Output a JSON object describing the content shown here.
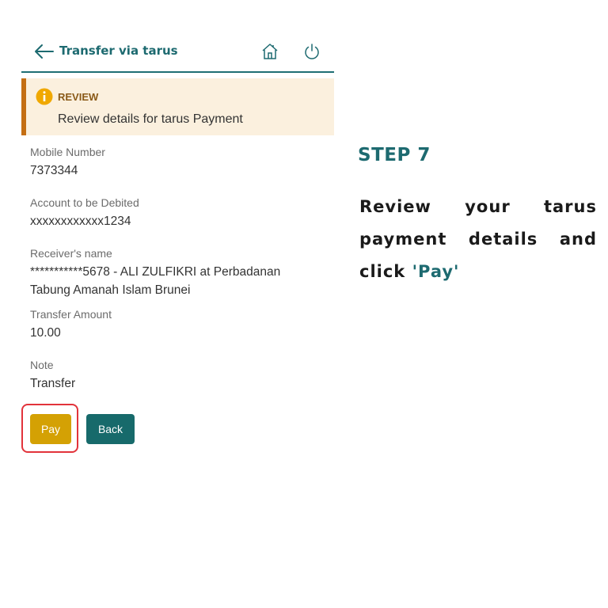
{
  "header": {
    "title": "Transfer via tarus",
    "icons": [
      "back-arrow-icon",
      "home-icon",
      "power-icon"
    ]
  },
  "review": {
    "title": "REVIEW",
    "text": "Review details for tarus Payment",
    "icon": "info-icon"
  },
  "fields": [
    {
      "label": "Mobile Number",
      "value": "7373344"
    },
    {
      "label": "Account to be Debited",
      "value": "xxxxxxxxxxxx1234"
    },
    {
      "label": "Receiver's name",
      "value": "***********5678 - ALI ZULFIKRI at Perbadanan Tabung Amanah Islam Brunei"
    },
    {
      "label": "Transfer Amount",
      "value": "10.00"
    },
    {
      "label": "Note",
      "value": "Transfer"
    }
  ],
  "actions": {
    "pay_label": "Pay",
    "back_label": "Back"
  },
  "instruction": {
    "step": "STEP 7",
    "text": "Review your tarus payment details and click",
    "highlight": "'Pay'"
  },
  "colors": {
    "teal": "#1d6a70",
    "pay_button": "#d4a104",
    "back_button": "#176a6b",
    "review_bg": "#fbf0de",
    "review_border": "#c46e12",
    "highlight_border": "#e2333b"
  }
}
